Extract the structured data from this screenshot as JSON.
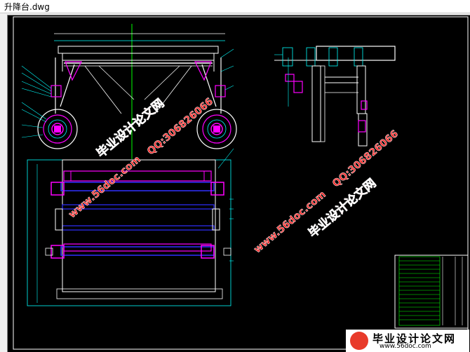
{
  "window": {
    "title": "升降台.dwg"
  },
  "watermarks": {
    "site_name": "毕业设计论文网",
    "qq": "QQ:306826066",
    "url": "www.56doc.com"
  },
  "logo": {
    "name": "毕业设计论文网",
    "url": "www.56doc.com"
  },
  "colors": {
    "canvas_background": "#000000",
    "line_white": "#ffffff",
    "line_cyan": "#00ffff",
    "line_magenta": "#ff00ff",
    "line_green": "#00ff00",
    "line_blue": "#3030ff",
    "watermark_red": "#ff2a2a"
  }
}
